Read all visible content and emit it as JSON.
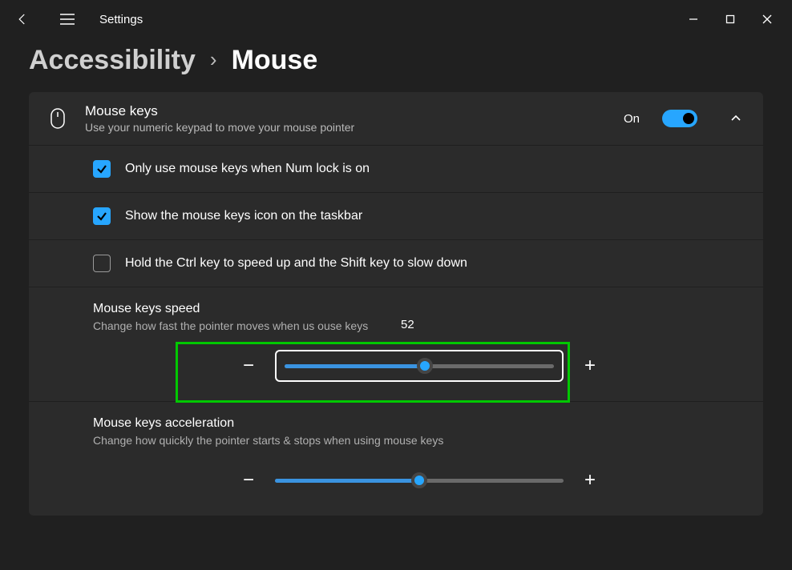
{
  "titlebar": {
    "app_name": "Settings"
  },
  "breadcrumb": {
    "parent": "Accessibility",
    "sep": "›",
    "current": "Mouse"
  },
  "expander": {
    "title": "Mouse keys",
    "subtitle": "Use your numeric keypad to move your mouse pointer",
    "state_label": "On"
  },
  "options": {
    "numlock": {
      "label": "Only use mouse keys when Num lock is on",
      "checked": true
    },
    "taskbar": {
      "label": "Show the mouse keys icon on the taskbar",
      "checked": true
    },
    "ctrlshift": {
      "label": "Hold the Ctrl key to speed up and the Shift key to slow down",
      "checked": false
    }
  },
  "speed": {
    "title": "Mouse keys speed",
    "subtitle": "Change how fast the pointer moves when us        ouse keys",
    "value_tooltip": "52",
    "value_pct": 52
  },
  "accel": {
    "title": "Mouse keys acceleration",
    "subtitle": "Change how quickly the pointer starts & stops when using mouse keys",
    "value_pct": 50
  },
  "glyphs": {
    "minus": "−",
    "plus": "+"
  }
}
